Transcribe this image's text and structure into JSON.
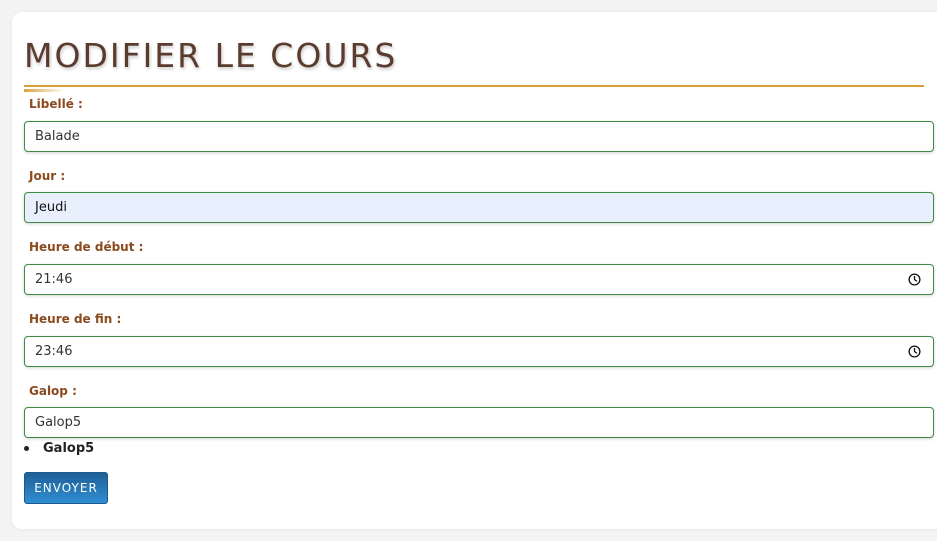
{
  "page": {
    "title": "MODIFIER LE COURS"
  },
  "form": {
    "libelle": {
      "label": "Libellé :",
      "value": "Balade"
    },
    "jour": {
      "label": "Jour :",
      "value": "Jeudi"
    },
    "heure_debut": {
      "label": "Heure de début :",
      "value": "21:46"
    },
    "heure_fin": {
      "label": "Heure de fin :",
      "value": "23:46"
    },
    "galop": {
      "label": "Galop :",
      "value": "Galop5"
    },
    "galop_list": [
      "Galop5"
    ],
    "submit_label": "ENVOYER"
  },
  "colors": {
    "title": "#5b3b2e",
    "accent_rule": "#d9a03a",
    "label": "#8b4a1e",
    "input_border": "#3f8a45",
    "button": "#1d5f96"
  },
  "icons": {
    "time_picker": "clock-icon"
  }
}
